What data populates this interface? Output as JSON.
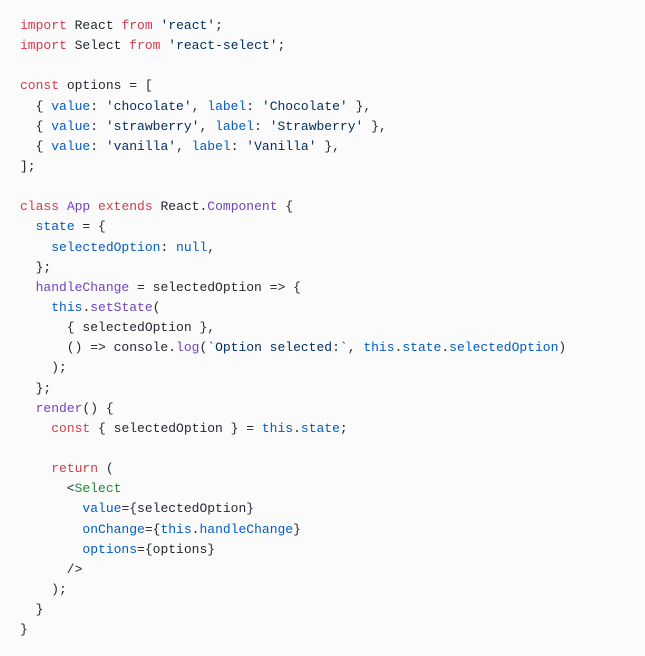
{
  "code": {
    "line1": {
      "import": "import",
      "react": "React",
      "from": "from",
      "module": "'react'"
    },
    "line2": {
      "import": "import",
      "select": "Select",
      "from": "from",
      "module": "'react-select'"
    },
    "line4": {
      "const": "const",
      "options": "options"
    },
    "line5": {
      "value_key": "value",
      "value_val": "'chocolate'",
      "label_key": "label",
      "label_val": "'Chocolate'"
    },
    "line6": {
      "value_key": "value",
      "value_val": "'strawberry'",
      "label_key": "label",
      "label_val": "'Strawberry'"
    },
    "line7": {
      "value_key": "value",
      "value_val": "'vanilla'",
      "label_key": "label",
      "label_val": "'Vanilla'"
    },
    "line10": {
      "class": "class",
      "app": "App",
      "extends": "extends",
      "react": "React",
      "component": "Component"
    },
    "line11": {
      "state": "state"
    },
    "line12": {
      "selectedOption": "selectedOption",
      "null": "null"
    },
    "line14": {
      "handleChange": "handleChange",
      "selectedOption": "selectedOption"
    },
    "line15": {
      "this": "this",
      "setState": "setState"
    },
    "line16": {
      "selectedOption": "selectedOption"
    },
    "line17": {
      "console": "console",
      "log": "log",
      "template": "`Option selected:`",
      "this": "this",
      "state": "state",
      "selectedOption": "selectedOption"
    },
    "line20": {
      "render": "render"
    },
    "line21": {
      "const": "const",
      "selectedOption": "selectedOption",
      "this": "this",
      "state": "state"
    },
    "line23": {
      "return": "return"
    },
    "line24": {
      "select": "Select"
    },
    "line25": {
      "value": "value",
      "selectedOption": "selectedOption"
    },
    "line26": {
      "onChange": "onChange",
      "this": "this",
      "handleChange": "handleChange"
    },
    "line27": {
      "options": "options",
      "options2": "options"
    }
  }
}
